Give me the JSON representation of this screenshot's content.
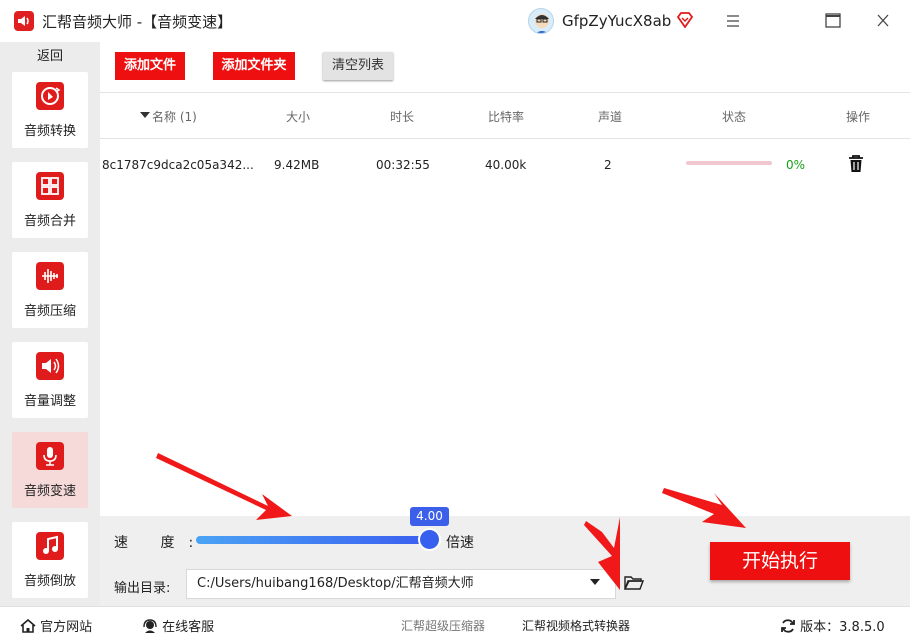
{
  "app": {
    "title": "汇帮音频大师   -【音频变速】",
    "username": "GfpZyYucX8ab"
  },
  "sidebar": {
    "back_label": "返回",
    "items": [
      {
        "label": "音频转换",
        "icon": "audio-convert-icon"
      },
      {
        "label": "音频合并",
        "icon": "audio-merge-icon"
      },
      {
        "label": "音频压缩",
        "icon": "audio-compress-icon"
      },
      {
        "label": "音量调整",
        "icon": "volume-adjust-icon"
      },
      {
        "label": "音频变速",
        "icon": "microphone-icon",
        "active": true
      },
      {
        "label": "音频倒放",
        "icon": "music-note-icon"
      }
    ]
  },
  "toolbar": {
    "add_file": "添加文件",
    "add_folder": "添加文件夹",
    "clear_list": "清空列表"
  },
  "table": {
    "headers": {
      "name": "名称 (1)",
      "size": "大小",
      "duration": "时长",
      "bitrate": "比特率",
      "channels": "声道",
      "status": "状态",
      "action": "操作"
    },
    "rows": [
      {
        "name": "8c1787c9dca2c05a342...",
        "size": "9.42MB",
        "duration": "00:32:55",
        "bitrate": "40.00k",
        "channels": "2",
        "status": "0%",
        "progress": 0
      }
    ]
  },
  "speed": {
    "label": "速 度:",
    "value": "4.00",
    "unit": "倍速",
    "fraction": 1.0
  },
  "output": {
    "label": "输出目录:",
    "path": "C:/Users/huibang168/Desktop/汇帮音频大师"
  },
  "start_label": "开始执行",
  "statusbar": {
    "website": "官方网站",
    "support": "在线客服",
    "link1": "汇帮超级压缩器",
    "link2": "汇帮视频格式转换器",
    "version_label": "版本：",
    "version": "3.8.5.0"
  },
  "colors": {
    "accent": "#ee1010",
    "slider": "#3b5fe8",
    "progress_text": "#17a017",
    "link_muted": "#777777"
  }
}
